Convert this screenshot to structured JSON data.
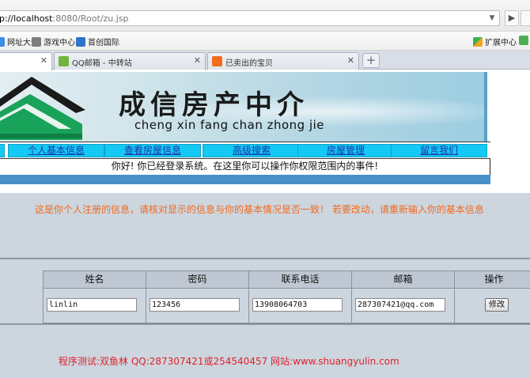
{
  "browser": {
    "url_host": "p://localhost",
    "url_rest": ":8080/Root/zu.jsp"
  },
  "bookmarks": [
    {
      "label": "网址大全",
      "icon": "globe-icon"
    },
    {
      "label": "游戏中心",
      "icon": "gamepad-icon"
    },
    {
      "label": "首创国际",
      "icon": "site-logo-icon"
    },
    {
      "label": "扩展中心",
      "icon": "extension-icon"
    }
  ],
  "tabs": [
    {
      "label": "",
      "icon": "page-icon"
    },
    {
      "label": "QQ邮箱 - 中转站",
      "icon": "qq-mail-icon"
    },
    {
      "label": "已卖出的宝贝",
      "icon": "taobao-icon"
    }
  ],
  "banner": {
    "title": "成信房产中介",
    "subtitle": "cheng xin fang chan zhong jie"
  },
  "nav": [
    {
      "label": "个人基本信息"
    },
    {
      "label": "查看房屋信息"
    },
    {
      "label": "高级搜索"
    },
    {
      "label": "房屋管理"
    },
    {
      "label": "留言我们"
    }
  ],
  "welcome": "你好! 你已经登录系统。在这里你可以操作你权限范围内的事件!",
  "notice": "这是你个人注册的信息，请核对显示的信息与你的基本情况是否一致！  若要改动，请重新输入你的基本信息",
  "table": {
    "headers": [
      "姓名",
      "密码",
      "联系电话",
      "邮箱",
      "操作"
    ],
    "row": {
      "name": "linlin",
      "password": "123456",
      "phone": "13908064703",
      "email": "287307421@qq.com",
      "action": "修改"
    }
  },
  "footer": "程序测试:双鱼林 QQ:287307421或254540457 网站:www.shuangyulin.com",
  "colors": {
    "nav_bg": "#14c9f4",
    "notice": "#f06a1e",
    "footer": "#e0202a",
    "page_bg": "#cdd6df"
  }
}
